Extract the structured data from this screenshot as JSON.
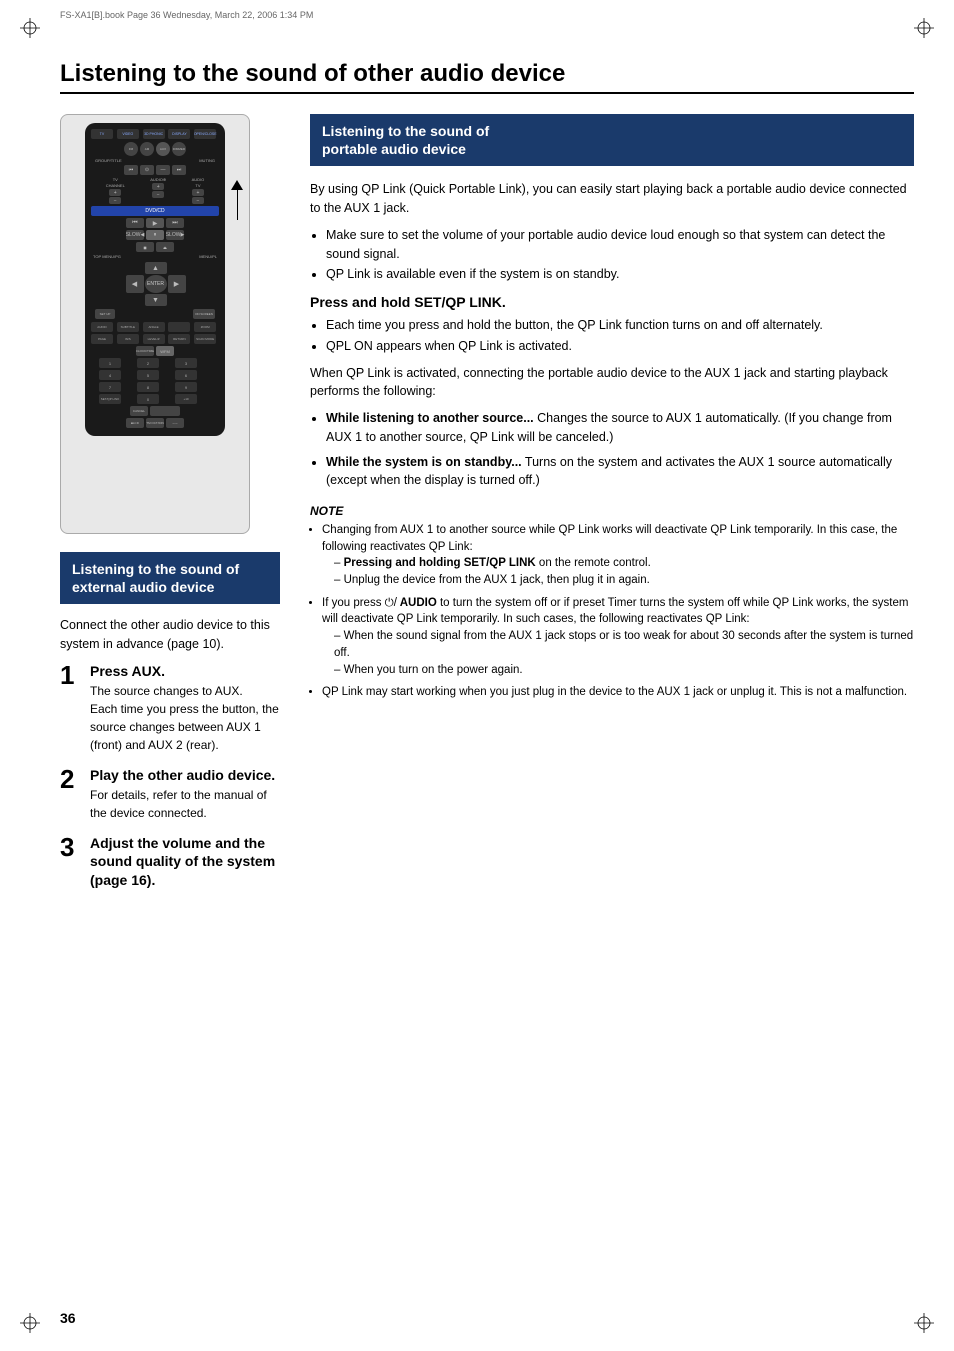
{
  "meta": {
    "file_info": "FS-XA1[B].book  Page 36  Wednesday, March 22, 2006  1:34 PM"
  },
  "page_title": "Listening to the sound of other audio device",
  "left_section": {
    "box_title": "Listening to the sound of\nexternal audio device",
    "intro": "Connect the other audio device to this system in advance (page 10).",
    "steps": [
      {
        "number": "1",
        "title": "Press AUX.",
        "body": "The source changes to AUX.\nEach time you press the button, the source changes between AUX 1 (front) and AUX 2 (rear)."
      },
      {
        "number": "2",
        "title": "Play the other audio device.",
        "body": "For details, refer to the manual of the device connected."
      },
      {
        "number": "3",
        "title": "Adjust the volume and the sound quality of the system (page 16).",
        "body": ""
      }
    ]
  },
  "right_section": {
    "box_title": "Listening to the sound of\nportable audio device",
    "intro": "By using QP Link (Quick Portable Link), you can easily start playing back a portable audio device connected to the AUX 1 jack.",
    "bullets": [
      "Make sure to set the volume of your portable audio device loud enough so that system can detect the sound signal.",
      "QP Link is available even if the system is on standby."
    ],
    "subsection_title": "Press and hold SET/QP LINK.",
    "subsection_bullets": [
      "Each time you press and hold the button, the QP Link function turns on and off alternately.",
      "QPL ON appears when QP Link is activated."
    ],
    "when_activated_intro": "When QP Link is activated, connecting the portable audio device to the AUX 1 jack and starting playback performs the following:",
    "when_activated_items": [
      {
        "bold_title": "While listening to another source...",
        "body": "Changes the source to AUX 1 automatically. (If you change from AUX 1 to another source, QP Link will be canceled.)"
      },
      {
        "bold_title": "While the system is on standby...",
        "body": "Turns on the system and activates the AUX 1 source automatically (except when the display is turned off.)"
      }
    ],
    "note_title": "NOTE",
    "notes": [
      {
        "text": "Changing from AUX 1 to another source while QP Link works will deactivate QP Link temporarily. In this case, the following reactivates QP Link:",
        "sub_items": [
          "Pressing and holding SET/QP LINK on the remote control.",
          "Unplug the device from the AUX 1 jack, then plug it in again."
        ]
      },
      {
        "text": "If you press ⎇/| AUDIO to turn the system off or if preset Timer turns the system off while QP Link works, the system will deactivate QP Link temporarily. In such cases, the following reactivates QP Link:",
        "sub_items": [
          "When the sound signal from the AUX 1 jack stops or is too weak for about 30 seconds after the system is turned off.",
          "When you turn on the power again."
        ]
      },
      {
        "text": "QP Link may start working when you just plug in the device to the AUX 1 jack or unplug it. This is not a malfunction.",
        "sub_items": []
      }
    ]
  },
  "page_number": "36"
}
